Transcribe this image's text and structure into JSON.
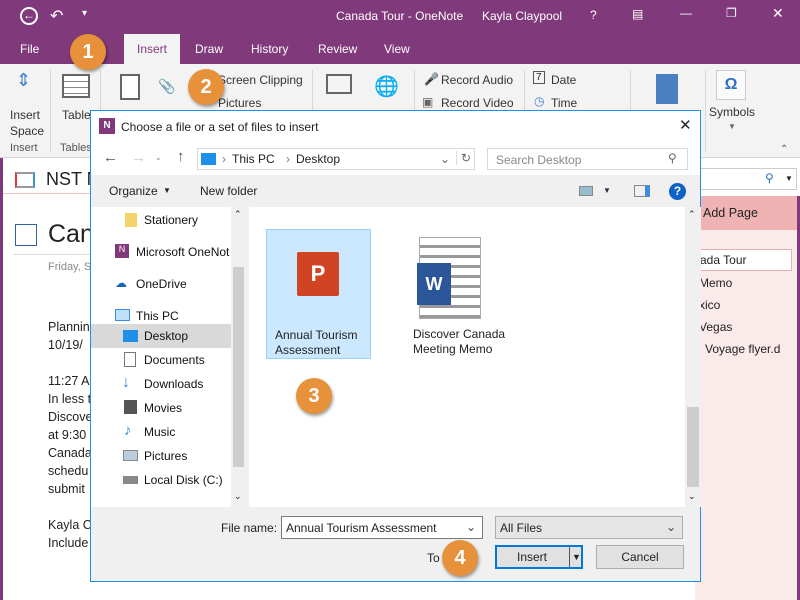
{
  "titlebar": {
    "title": "Canada Tour - OneNote",
    "user": "Kayla Claypool",
    "help": "?"
  },
  "tabs": [
    "File",
    "Insert",
    "Draw",
    "History",
    "Review",
    "View"
  ],
  "ribbon": {
    "insert_space": [
      "Insert",
      "Space"
    ],
    "insert_group": "Insert",
    "table": "Table",
    "tables_group": "Tables",
    "screen_clipping": "Screen Clipping",
    "pictures": "Pictures",
    "record_audio": "Record Audio",
    "record_video": "Record Video",
    "date": "Date",
    "time": "Time",
    "symbols": "Symbols"
  },
  "notebook": {
    "name": "NST N",
    "page_title": "Can",
    "page_date": "Friday, S",
    "lines": [
      "Plannin",
      "10/19/",
      "",
      "11:27 A",
      "In less t",
      "Discove",
      "at 9:30",
      "Canada",
      "schedu",
      "submit",
      "",
      "Kayla C",
      "Include"
    ]
  },
  "pages_pane": {
    "add_page": "Add Page",
    "pages": [
      "ada Tour",
      "Memo",
      "xico",
      "Vegas",
      "Voyage flyer.d"
    ]
  },
  "dialog": {
    "title": "Choose a file or a set of files to insert",
    "breadcrumb": [
      "This PC",
      "Desktop"
    ],
    "search_placeholder": "Search Desktop",
    "organize": "Organize",
    "new_folder": "New folder",
    "nav": [
      "Stationery",
      "Microsoft OneNot",
      "OneDrive",
      "This PC",
      "Desktop",
      "Documents",
      "Downloads",
      "Movies",
      "Music",
      "Pictures",
      "Local Disk (C:)"
    ],
    "files": [
      {
        "name": [
          "Annual Tourism",
          "Assessment"
        ],
        "type": "powerpoint"
      },
      {
        "name": [
          "Discover Canada",
          "Meeting Memo"
        ],
        "type": "word"
      }
    ],
    "file_name_label": "File name:",
    "file_name_value": "Annual Tourism Assessment",
    "filter": "All Files",
    "tools": "To",
    "insert": "Insert",
    "cancel": "Cancel"
  },
  "badges": [
    "1",
    "2",
    "3",
    "4"
  ],
  "colors": {
    "accent": "#80397b",
    "badge": "#e8913b",
    "selection": "#cce8ff",
    "dialog_border": "#1e90e8"
  }
}
